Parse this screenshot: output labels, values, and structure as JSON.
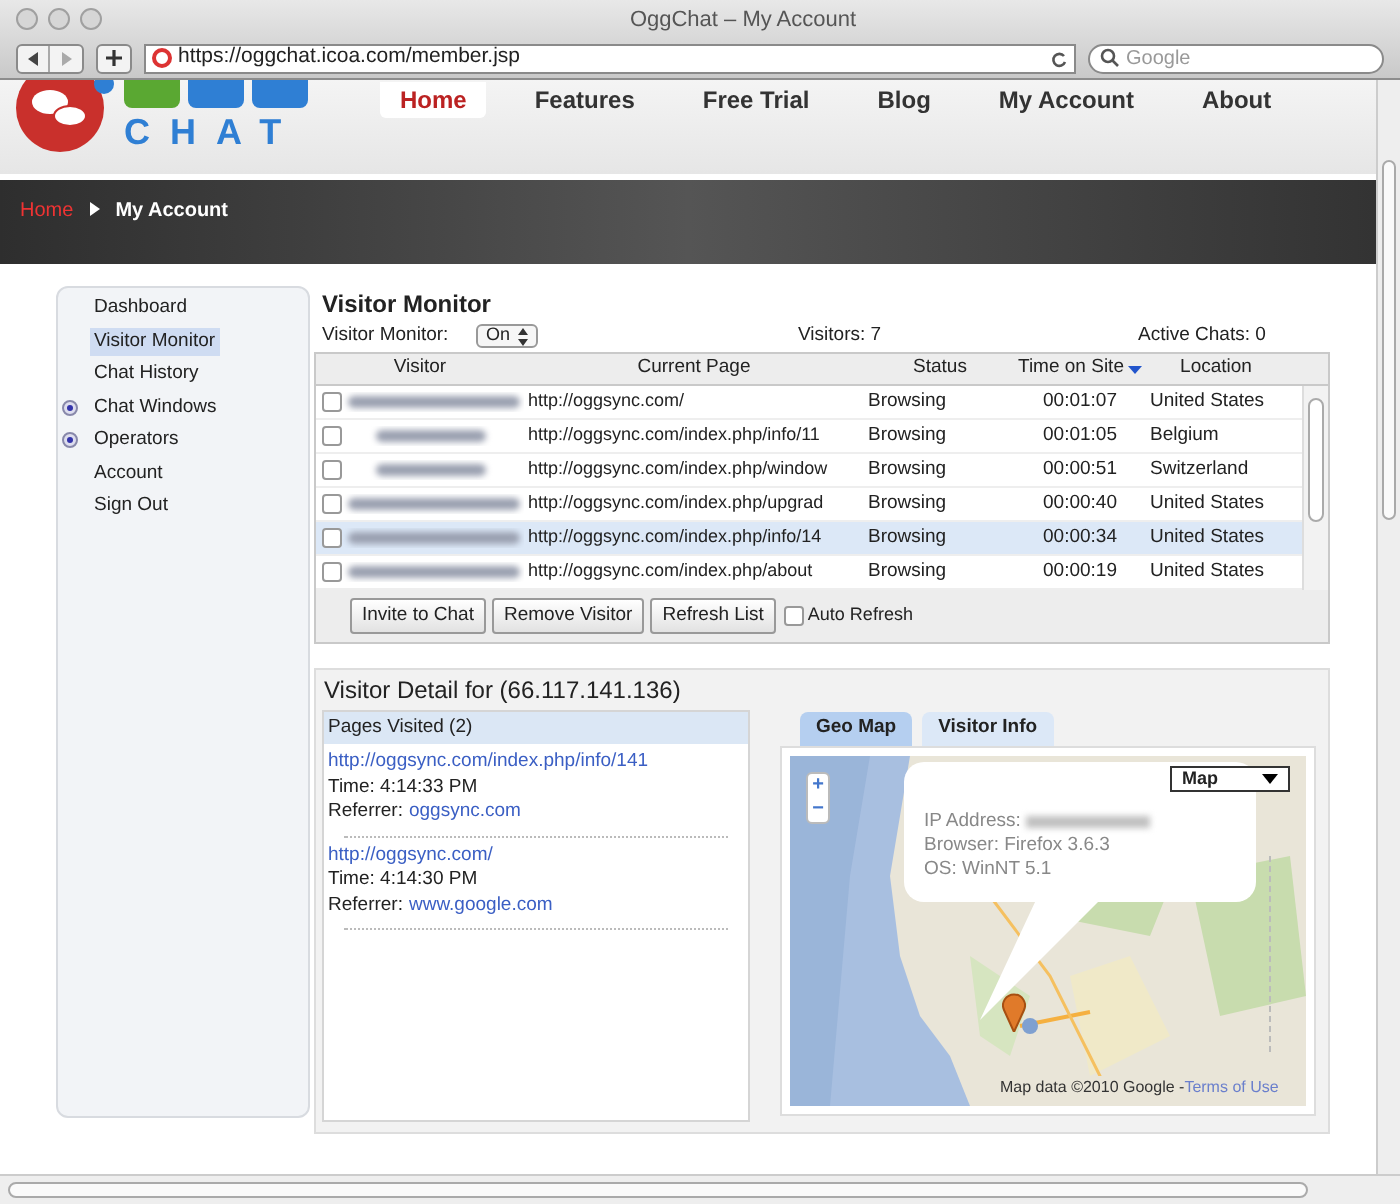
{
  "window": {
    "title": "OggChat – My Account"
  },
  "toolbar": {
    "url": "https://oggchat.icoa.com/member.jsp",
    "search_placeholder": "Google"
  },
  "logo": {
    "text": "CHAT"
  },
  "nav": [
    {
      "label": "Home",
      "selected": true
    },
    {
      "label": "Features",
      "selected": false
    },
    {
      "label": "Free Trial",
      "selected": false
    },
    {
      "label": "Blog",
      "selected": false
    },
    {
      "label": "My Account",
      "selected": false
    },
    {
      "label": "About",
      "selected": false
    }
  ],
  "breadcrumb": [
    "Home",
    "My Account"
  ],
  "sidebar": {
    "items": [
      {
        "label": "Dashboard",
        "selected": false,
        "expandable": false
      },
      {
        "label": "Visitor Monitor",
        "selected": true,
        "expandable": false
      },
      {
        "label": "Chat History",
        "selected": false,
        "expandable": false
      },
      {
        "label": "Chat Windows",
        "selected": false,
        "expandable": true
      },
      {
        "label": "Operators",
        "selected": false,
        "expandable": true
      },
      {
        "label": "Account",
        "selected": false,
        "expandable": false
      },
      {
        "label": "Sign Out",
        "selected": false,
        "expandable": false
      }
    ]
  },
  "monitor": {
    "title": "Visitor Monitor",
    "toggle_label": "Visitor Monitor:",
    "toggle_value": "On",
    "visitors": "Visitors:  7",
    "active_chats": "Active Chats:  0",
    "columns": [
      {
        "label": "Visitor",
        "sorted": false
      },
      {
        "label": "Current Page",
        "sorted": false
      },
      {
        "label": "Status",
        "sorted": false
      },
      {
        "label": "Time on Site",
        "sorted": true
      },
      {
        "label": "Location",
        "sorted": false
      }
    ],
    "rows": [
      {
        "kind": "host",
        "page": "http://oggsync.com/",
        "status": "Browsing",
        "time": "00:01:07",
        "location": "United States",
        "checked": false,
        "selected": false
      },
      {
        "kind": "ip",
        "page": "http://oggsync.com/index.php/info/11",
        "status": "Browsing",
        "time": "00:01:05",
        "location": "Belgium",
        "checked": false,
        "selected": false
      },
      {
        "kind": "ip",
        "page": "http://oggsync.com/index.php/window",
        "status": "Browsing",
        "time": "00:00:51",
        "location": "Switzerland",
        "checked": false,
        "selected": false
      },
      {
        "kind": "host",
        "page": "http://oggsync.com/index.php/upgrad",
        "status": "Browsing",
        "time": "00:00:40",
        "location": "United States",
        "checked": false,
        "selected": false
      },
      {
        "kind": "host",
        "page": "http://oggsync.com/index.php/info/14",
        "status": "Browsing",
        "time": "00:00:34",
        "location": "United States",
        "checked": false,
        "selected": true
      },
      {
        "kind": "host",
        "page": "http://oggsync.com/index.php/about",
        "status": "Browsing",
        "time": "00:00:19",
        "location": "United States",
        "checked": false,
        "selected": false
      }
    ],
    "buttons": [
      "Invite to Chat",
      "Remove Visitor",
      "Refresh List"
    ],
    "auto_refresh": {
      "label": "Auto Refresh",
      "checked": false
    }
  },
  "detail": {
    "title": "Visitor Detail for (66.117.141.136)",
    "pages_header": "Pages Visited (2)",
    "pages": [
      {
        "url": "http://oggsync.com/index.php/info/141",
        "time": "Time: 4:14:33 PM",
        "referrer_label": "Referrer:",
        "referrer": "oggsync.com"
      },
      {
        "url": "http://oggsync.com/",
        "time": "Time: 4:14:30 PM",
        "referrer_label": "Referrer:",
        "referrer": "www.google.com"
      }
    ],
    "tabs": [
      {
        "label": "Geo Map",
        "selected": true
      },
      {
        "label": "Visitor Info",
        "selected": false
      }
    ],
    "map": {
      "type_select": "Map",
      "zoom_in": "+",
      "zoom_out": "−",
      "ip_label": "IP Address:",
      "browser": "Browser: Firefox 3.6.3",
      "os": "OS: WinNT 5.1",
      "attribution": "Map data ©2010 Google - ",
      "terms": "Terms of Use"
    }
  }
}
